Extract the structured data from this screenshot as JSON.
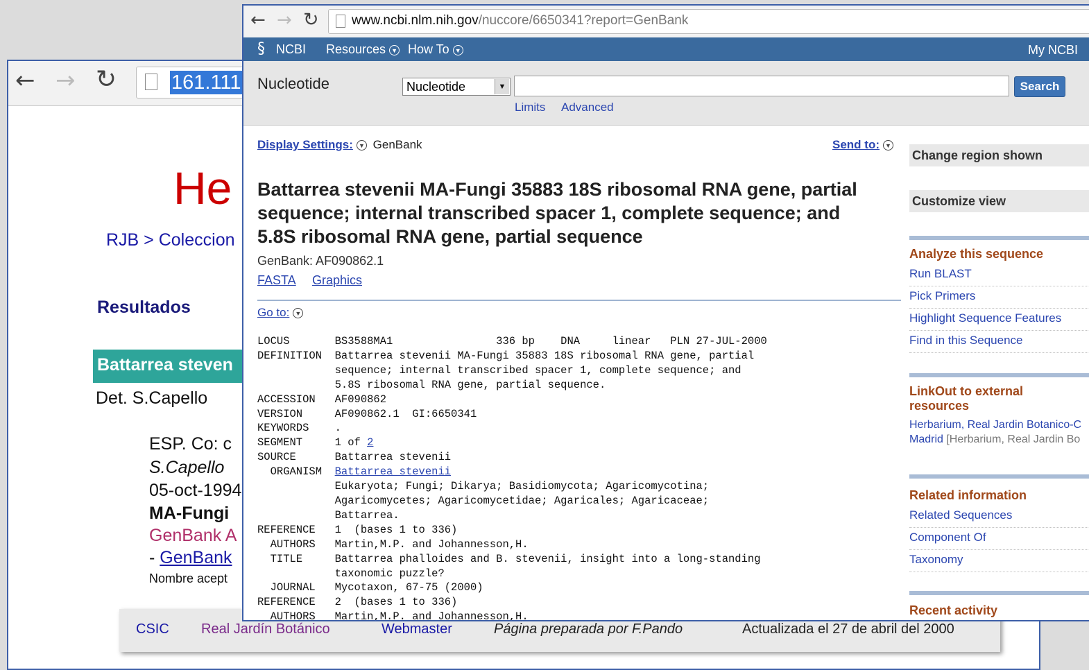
{
  "back_window": {
    "url_selected": "161.111",
    "title_partial": "He",
    "breadcrumb": "RJB > Coleccion",
    "results_heading": "Resultados",
    "teal_bar": "Battarrea steven",
    "det_line": "Det. S.Capello",
    "lines": [
      "ESP. Co: c",
      "S.Capello",
      "05-oct-1994",
      "MA-Fungi",
      "GenBank A",
      "- ",
      "GenBank",
      "Nombre acept"
    ],
    "footer": {
      "csic": "CSIC",
      "rjb": "Real Jardín Botánico",
      "webmaster": "Webmaster",
      "prepared_by": "Página preparada por F.Pando",
      "updated": "Actualizada el 27 de abril del 2000"
    }
  },
  "front_window": {
    "url": {
      "host": "www.ncbi.nlm.nih.gov",
      "path": "/nuccore/6650341?report=GenBank"
    },
    "ncbi_bar": {
      "logo": "NCBI",
      "resources": "Resources",
      "howto": "How To",
      "myncbi": "My NCBI"
    },
    "search": {
      "db_label": "Nucleotide",
      "db_selected": "Nucleotide",
      "query": "",
      "button": "Search",
      "limits": "Limits",
      "advanced": "Advanced"
    },
    "display_settings": {
      "label": "Display Settings:",
      "value": "GenBank"
    },
    "send_to": "Send to:",
    "record": {
      "title_lines": [
        "Battarrea stevenii MA-Fungi 35883 18S ribosomal RNA gene, partial",
        "sequence; internal transcribed spacer 1, complete sequence; and",
        "5.8S ribosomal RNA gene, partial sequence"
      ],
      "genbank_id": "GenBank: AF090862.1",
      "fasta": "FASTA",
      "graphics": "Graphics",
      "goto": "Go to:"
    },
    "flatfile": {
      "locus": "LOCUS       BS3588MA1                336 bp    DNA     linear   PLN 27-JUL-2000",
      "def1": "DEFINITION  Battarrea stevenii MA-Fungi 35883 18S ribosomal RNA gene, partial",
      "def2": "            sequence; internal transcribed spacer 1, complete sequence; and",
      "def3": "            5.8S ribosomal RNA gene, partial sequence.",
      "accession": "ACCESSION   AF090862",
      "version": "VERSION     AF090862.1  GI:6650341",
      "keywords": "KEYWORDS    .",
      "segment_pre": "SEGMENT     1 of ",
      "segment_link": "2",
      "source": "SOURCE      Battarrea stevenii",
      "organism_pre": "  ORGANISM  ",
      "organism_link": "Battarrea stevenii",
      "tax1": "            Eukaryota; Fungi; Dikarya; Basidiomycota; Agaricomycotina;",
      "tax2": "            Agaricomycetes; Agaricomycetidae; Agaricales; Agaricaceae;",
      "tax3": "            Battarrea.",
      "ref1": "REFERENCE   1  (bases 1 to 336)",
      "auth1": "  AUTHORS   Martin,M.P. and Johannesson,H.",
      "title1": "  TITLE     Battarrea phalloides and B. stevenii, insight into a long-standing",
      "title2": "            taxonomic puzzle?",
      "journal": "  JOURNAL   Mycotaxon, 67-75 (2000)",
      "ref2": "REFERENCE   2  (bases 1 to 336)",
      "auth2": "  AUTHORS   Martin,M.P. and Johannesson,H."
    },
    "rail": {
      "change_region": "Change region shown",
      "customize": "Customize view",
      "analyze_head": "Analyze this sequence",
      "analyze_items": [
        "Run BLAST",
        "Pick Primers",
        "Highlight Sequence Features",
        "Find in this Sequence"
      ],
      "linkout_head1": "LinkOut to external",
      "linkout_head2": "resources",
      "linkout_line1": "Herbarium, Real Jardin Botanico-C",
      "linkout_line2a": "Madrid ",
      "linkout_line2b": "[Herbarium, Real Jardin Bo",
      "related_head": "Related information",
      "related_items": [
        "Related Sequences",
        "Component Of",
        "Taxonomy"
      ],
      "recent_head": "Recent activity"
    }
  }
}
